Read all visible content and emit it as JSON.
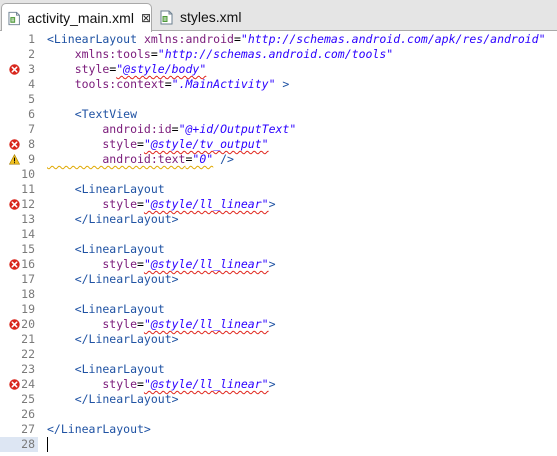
{
  "tabs": [
    {
      "label": "activity_main.xml",
      "active": true,
      "close_glyph": "⊠"
    },
    {
      "label": "styles.xml",
      "active": false
    }
  ],
  "editor": {
    "current_line": 28,
    "lines": [
      {
        "n": "1",
        "marker": null,
        "parts": [
          {
            "t": "<LinearLayout ",
            "c": "tag"
          },
          {
            "t": "xmlns:android",
            "c": "attr"
          },
          {
            "t": "=",
            "c": "eq"
          },
          {
            "t": "\"http://schemas.android.com/apk/res/android\"",
            "c": "val"
          }
        ]
      },
      {
        "n": "2",
        "marker": null,
        "parts": [
          {
            "t": "    xmlns:tools",
            "c": "attr"
          },
          {
            "t": "=",
            "c": "eq"
          },
          {
            "t": "\"http://schemas.android.com/tools\"",
            "c": "val"
          }
        ]
      },
      {
        "n": "3",
        "marker": "error",
        "parts": [
          {
            "t": "    style",
            "c": "attr"
          },
          {
            "t": "=",
            "c": "eq"
          },
          {
            "t": "\"@style/body\"",
            "c": "val sq-red"
          }
        ]
      },
      {
        "n": "4",
        "marker": null,
        "parts": [
          {
            "t": "    tools:context",
            "c": "attr"
          },
          {
            "t": "=",
            "c": "eq"
          },
          {
            "t": "\".MainActivity\"",
            "c": "val"
          },
          {
            "t": " >",
            "c": "tag"
          }
        ]
      },
      {
        "n": "5",
        "marker": null,
        "parts": []
      },
      {
        "n": "6",
        "marker": null,
        "parts": [
          {
            "t": "    <TextView",
            "c": "tag"
          }
        ]
      },
      {
        "n": "7",
        "marker": null,
        "parts": [
          {
            "t": "        android:id",
            "c": "attr"
          },
          {
            "t": "=",
            "c": "eq"
          },
          {
            "t": "\"@+id/OutputText\"",
            "c": "val"
          }
        ]
      },
      {
        "n": "8",
        "marker": "error",
        "parts": [
          {
            "t": "        style",
            "c": "attr"
          },
          {
            "t": "=",
            "c": "eq"
          },
          {
            "t": "\"@style/tv_output\"",
            "c": "val sq-red"
          }
        ]
      },
      {
        "n": "9",
        "marker": "warning",
        "parts": [
          {
            "t": "        android:text",
            "c": "attr sq-yel"
          },
          {
            "t": "=",
            "c": "eq sq-yel"
          },
          {
            "t": "\"0\"",
            "c": "val sq-yel"
          },
          {
            "t": " />",
            "c": "tag"
          }
        ]
      },
      {
        "n": "10",
        "marker": null,
        "parts": []
      },
      {
        "n": "11",
        "marker": null,
        "parts": [
          {
            "t": "    <LinearLayout",
            "c": "tag"
          }
        ]
      },
      {
        "n": "12",
        "marker": "error",
        "parts": [
          {
            "t": "        style",
            "c": "attr"
          },
          {
            "t": "=",
            "c": "eq"
          },
          {
            "t": "\"@style/ll_linear\"",
            "c": "val sq-red"
          },
          {
            "t": ">",
            "c": "tag"
          }
        ]
      },
      {
        "n": "13",
        "marker": null,
        "parts": [
          {
            "t": "    </LinearLayout>",
            "c": "tag"
          }
        ]
      },
      {
        "n": "14",
        "marker": null,
        "parts": []
      },
      {
        "n": "15",
        "marker": null,
        "parts": [
          {
            "t": "    <LinearLayout",
            "c": "tag"
          }
        ]
      },
      {
        "n": "16",
        "marker": "error",
        "parts": [
          {
            "t": "        style",
            "c": "attr"
          },
          {
            "t": "=",
            "c": "eq"
          },
          {
            "t": "\"@style/ll_linear\"",
            "c": "val sq-red"
          },
          {
            "t": ">",
            "c": "tag"
          }
        ]
      },
      {
        "n": "17",
        "marker": null,
        "parts": [
          {
            "t": "    </LinearLayout>",
            "c": "tag"
          }
        ]
      },
      {
        "n": "18",
        "marker": null,
        "parts": []
      },
      {
        "n": "19",
        "marker": null,
        "parts": [
          {
            "t": "    <LinearLayout",
            "c": "tag"
          }
        ]
      },
      {
        "n": "20",
        "marker": "error",
        "parts": [
          {
            "t": "        style",
            "c": "attr"
          },
          {
            "t": "=",
            "c": "eq"
          },
          {
            "t": "\"@style/ll_linear\"",
            "c": "val sq-red"
          },
          {
            "t": ">",
            "c": "tag"
          }
        ]
      },
      {
        "n": "21",
        "marker": null,
        "parts": [
          {
            "t": "    </LinearLayout>",
            "c": "tag"
          }
        ]
      },
      {
        "n": "22",
        "marker": null,
        "parts": []
      },
      {
        "n": "23",
        "marker": null,
        "parts": [
          {
            "t": "    <LinearLayout",
            "c": "tag"
          }
        ]
      },
      {
        "n": "24",
        "marker": "error",
        "parts": [
          {
            "t": "        style",
            "c": "attr"
          },
          {
            "t": "=",
            "c": "eq"
          },
          {
            "t": "\"@style/ll_linear\"",
            "c": "val sq-red"
          },
          {
            "t": ">",
            "c": "tag"
          }
        ]
      },
      {
        "n": "25",
        "marker": null,
        "parts": [
          {
            "t": "    </LinearLayout>",
            "c": "tag"
          }
        ]
      },
      {
        "n": "26",
        "marker": null,
        "parts": []
      },
      {
        "n": "27",
        "marker": null,
        "parts": [
          {
            "t": "</LinearLayout>",
            "c": "tag"
          }
        ]
      },
      {
        "n": "28",
        "marker": null,
        "parts": []
      }
    ]
  },
  "icons": {
    "error": "error-icon",
    "warning": "warning-icon",
    "file": "xml-file-icon"
  },
  "colors": {
    "tag": "#1f52a3",
    "attribute": "#7a1a7a",
    "value": "#2a00ff",
    "error": "#d8261c",
    "warning": "#f0c020",
    "current_line": "#dde6f3"
  }
}
